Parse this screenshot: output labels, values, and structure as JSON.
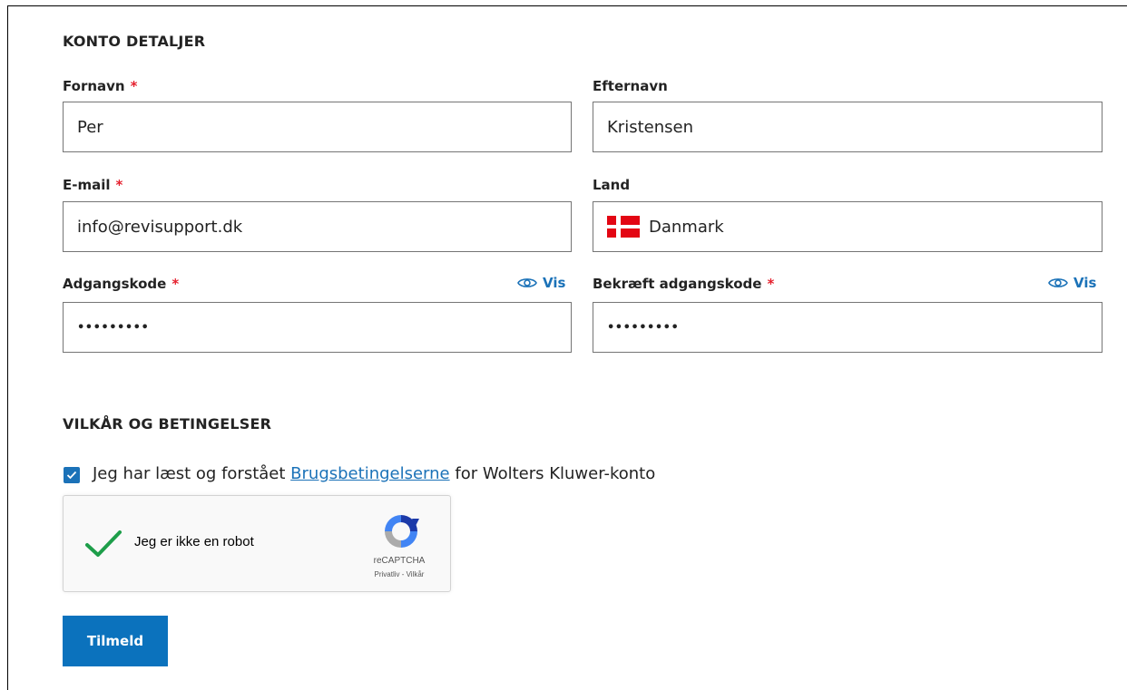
{
  "account": {
    "section_title": "KONTO DETALJER",
    "first_name": {
      "label": "Fornavn",
      "required_mark": "*",
      "value": "Per"
    },
    "last_name": {
      "label": "Efternavn",
      "value": "Kristensen"
    },
    "email": {
      "label": "E-mail",
      "required_mark": "*",
      "value": "info@revisupport.dk"
    },
    "country": {
      "label": "Land",
      "value": "Danmark",
      "flag_icon": "denmark-flag-icon"
    },
    "password": {
      "label": "Adgangskode",
      "required_mark": "*",
      "value": "•••••••••",
      "show_label": "Vis"
    },
    "confirm_password": {
      "label": "Bekræft adgangskode",
      "required_mark": "*",
      "value": "•••••••••",
      "show_label": "Vis"
    }
  },
  "terms": {
    "section_title": "VILKÅR OG BETINGELSER",
    "checked": true,
    "text_before": "Jeg har læst og forstået",
    "link_text": "Brugsbetingelserne",
    "text_after": "for Wolters Kluwer-konto"
  },
  "captcha": {
    "label": "Jeg er ikke en robot",
    "brand": "reCAPTCHA",
    "links": "Privatliv - Vilkår",
    "checked": true
  },
  "submit": {
    "label": "Tilmeld"
  },
  "colors": {
    "accent": "#1b72b8",
    "button": "#0b72bd",
    "required": "#e5202e"
  }
}
